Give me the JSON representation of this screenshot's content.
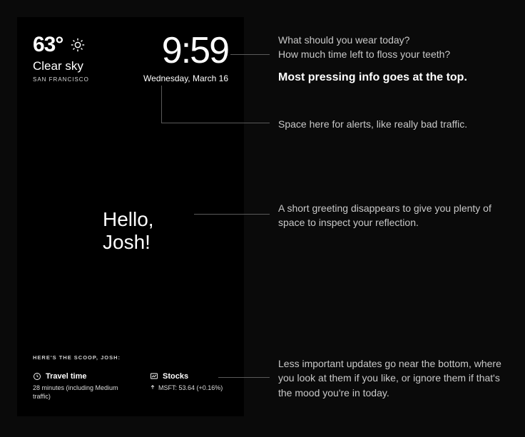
{
  "mirror": {
    "weather": {
      "temp": "63°",
      "condition": "Clear sky",
      "location": "SAN FRANCISCO"
    },
    "clock": {
      "time": "9:59",
      "date": "Wednesday, March 16"
    },
    "greeting": {
      "line1": "Hello,",
      "line2": "Josh!"
    },
    "scoop_label": "HERE'S THE SCOOP, JOSH:",
    "widgets": {
      "travel": {
        "title": "Travel time",
        "body": "28 minutes (including Medium traffic)"
      },
      "stocks": {
        "title": "Stocks",
        "body": "MSFT: 53.64 (+0.16%)"
      }
    }
  },
  "annotations": {
    "top": {
      "q1": "What should you wear today?",
      "q2": "How much time left to floss your teeth?",
      "summary": "Most pressing info goes at the top."
    },
    "alerts": "Space here for alerts, like really bad traffic.",
    "greeting": "A short greeting disappears to give you plenty of space to inspect your reflection.",
    "bottom": "Less important updates go near the bottom, where you look at them if you like, or ignore them if that's the mood you're in today."
  }
}
